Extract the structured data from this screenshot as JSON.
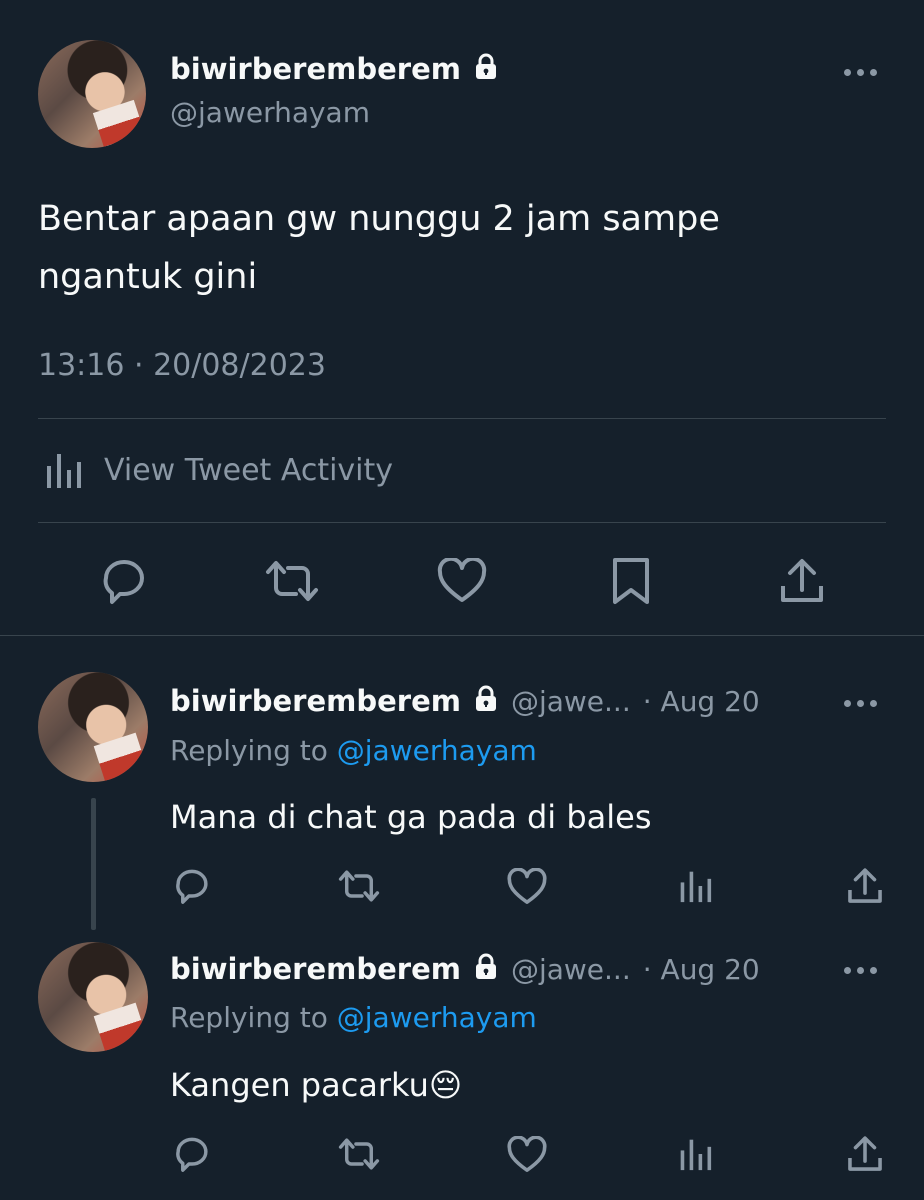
{
  "main_tweet": {
    "display_name": "biwirberemberem",
    "handle": "@jawerhayam",
    "text_line1": "Bentar apaan gw nunggu 2 jam sampe",
    "text_line2": "ngantuk gini",
    "timestamp": "13:16 · 20/08/2023",
    "activity_label": "View Tweet Activity",
    "actions": [
      "reply-icon",
      "retweet-icon",
      "like-icon",
      "bookmark-icon",
      "share-icon"
    ]
  },
  "replies": [
    {
      "display_name": "biwirberemberem",
      "handle": "@jawe...",
      "time": "· Aug 20",
      "replying_prefix": "Replying to",
      "replying_to": "@jawerhayam",
      "text": "Mana di chat ga pada di bales"
    },
    {
      "display_name": "biwirberemberem",
      "handle": "@jawe...",
      "time": "· Aug 20",
      "replying_prefix": "Replying to",
      "replying_to": "@jawerhayam",
      "text": "Kangen pacarku😔"
    }
  ],
  "colors": {
    "background": "#15202b",
    "text": "#f7f9f9",
    "secondary": "#8b98a5",
    "accent": "#1d9bf0",
    "divider": "#38444d"
  }
}
